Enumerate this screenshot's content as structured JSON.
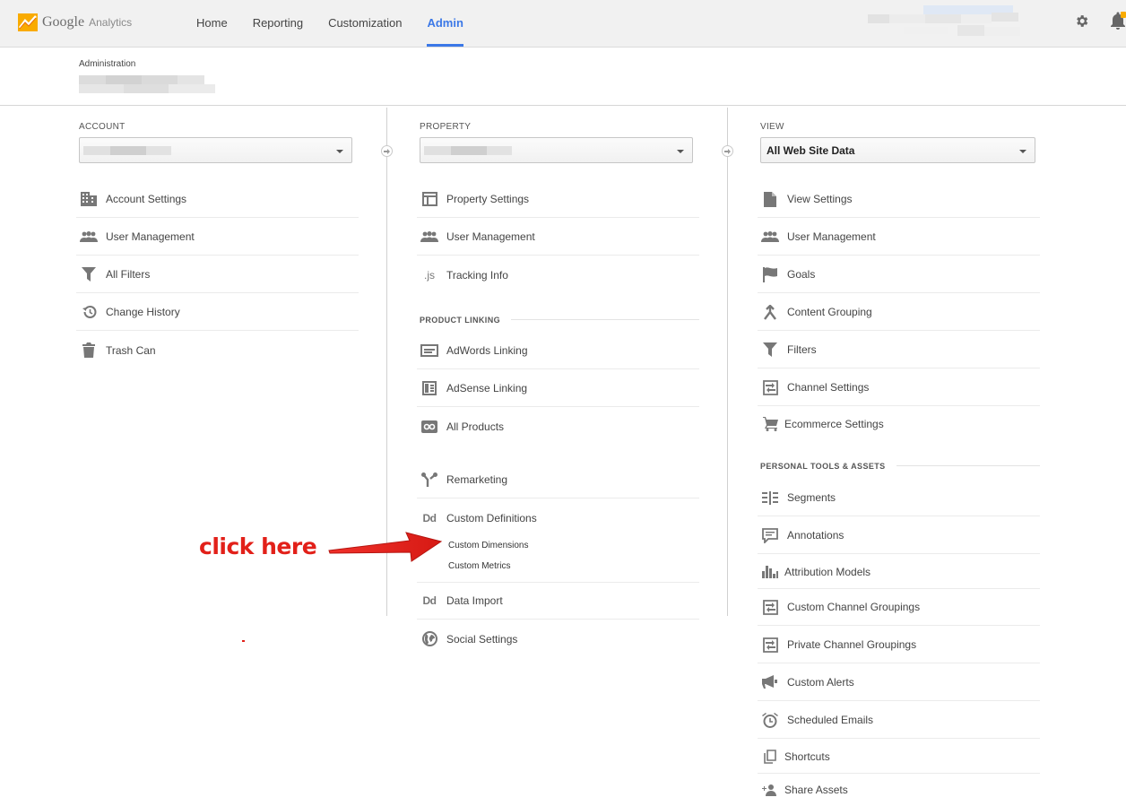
{
  "app": {
    "brand": "Google",
    "product": "Analytics",
    "accent_color": "#3b78e7",
    "logo_colors": [
      "#f9ab00",
      "#e8710a"
    ]
  },
  "nav": {
    "home": "Home",
    "reporting": "Reporting",
    "customization": "Customization",
    "admin": "Admin",
    "active": "admin"
  },
  "topbar": {
    "settings_icon": "gear-icon",
    "notifications_icon": "bell-icon"
  },
  "admin": {
    "title": "Administration"
  },
  "account": {
    "label": "ACCOUNT",
    "items": [
      {
        "label": "Account Settings",
        "icon": "building-icon"
      },
      {
        "label": "User Management",
        "icon": "users-icon"
      },
      {
        "label": "All Filters",
        "icon": "filter-icon"
      },
      {
        "label": "Change History",
        "icon": "history-icon"
      },
      {
        "label": "Trash Can",
        "icon": "trash-icon"
      }
    ]
  },
  "property": {
    "label": "PROPERTY",
    "items": [
      {
        "label": "Property Settings",
        "icon": "window-icon"
      },
      {
        "label": "User Management",
        "icon": "users-icon"
      },
      {
        "label": "Tracking Info",
        "icon": "js-icon",
        "glyph": ".js"
      }
    ],
    "product_linking": {
      "heading": "PRODUCT LINKING",
      "items": [
        {
          "label": "AdWords Linking",
          "icon": "adwords-icon"
        },
        {
          "label": "AdSense Linking",
          "icon": "adsense-icon"
        },
        {
          "label": "All Products",
          "icon": "link-icon"
        }
      ]
    },
    "more": [
      {
        "label": "Remarketing",
        "icon": "remarketing-icon"
      },
      {
        "label": "Custom Definitions",
        "icon": "dd-icon",
        "glyph": "Dd",
        "subitems": [
          "Custom Dimensions",
          "Custom Metrics"
        ]
      },
      {
        "label": "Data Import",
        "icon": "dd-icon",
        "glyph": "Dd"
      },
      {
        "label": "Social Settings",
        "icon": "globe-icon"
      }
    ]
  },
  "view": {
    "label": "VIEW",
    "selected": "All Web Site Data",
    "items": [
      {
        "label": "View Settings",
        "icon": "document-icon"
      },
      {
        "label": "User Management",
        "icon": "users-icon"
      },
      {
        "label": "Goals",
        "icon": "flag-icon"
      },
      {
        "label": "Content Grouping",
        "icon": "content-grouping-icon"
      },
      {
        "label": "Filters",
        "icon": "filter-icon"
      },
      {
        "label": "Channel Settings",
        "icon": "channel-icon"
      },
      {
        "label": "Ecommerce Settings",
        "icon": "cart-icon"
      }
    ],
    "personal": {
      "heading": "PERSONAL TOOLS & ASSETS",
      "items": [
        {
          "label": "Segments",
          "icon": "segments-icon"
        },
        {
          "label": "Annotations",
          "icon": "comment-icon"
        },
        {
          "label": "Attribution Models",
          "icon": "bar-chart-icon"
        },
        {
          "label": "Custom Channel Groupings",
          "icon": "channel-icon"
        },
        {
          "label": "Private Channel Groupings",
          "icon": "channel-icon"
        },
        {
          "label": "Custom Alerts",
          "icon": "megaphone-icon"
        },
        {
          "label": "Scheduled Emails",
          "icon": "alarm-clock-icon"
        },
        {
          "label": "Shortcuts",
          "icon": "copy-icon"
        },
        {
          "label": "Share Assets",
          "icon": "add-user-icon"
        }
      ]
    }
  },
  "annotation": {
    "text": "click here",
    "color": "#e22019"
  }
}
